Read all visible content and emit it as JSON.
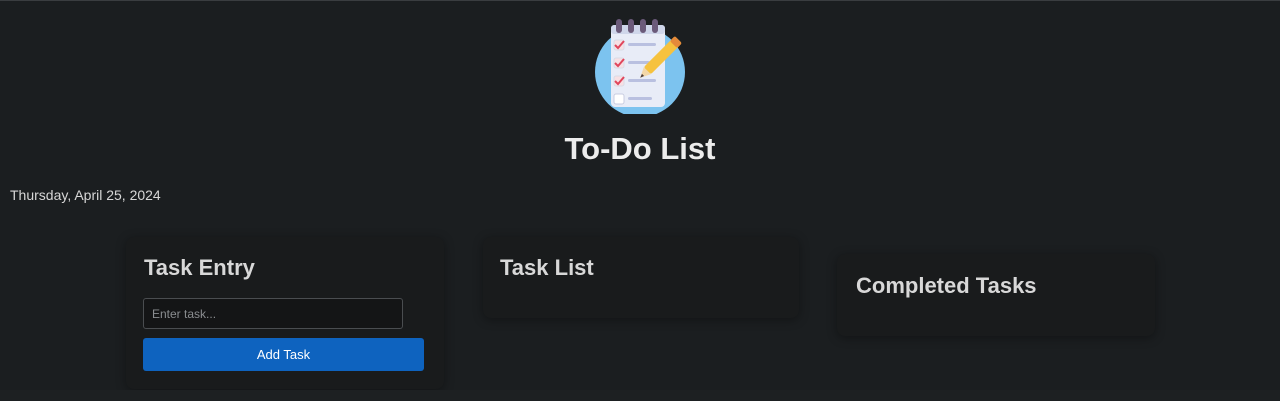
{
  "app": {
    "title": "To-Do List",
    "logo_icon": "notepad-checklist-pencil-icon",
    "date": "Thursday, April 25, 2024"
  },
  "task_entry": {
    "heading": "Task Entry",
    "input_value": "",
    "input_placeholder": "Enter task...",
    "add_button_label": "Add Task"
  },
  "task_list": {
    "heading": "Task List",
    "items": []
  },
  "completed_tasks": {
    "heading": "Completed Tasks",
    "items": []
  },
  "colors": {
    "background": "#1b1e20",
    "card": "#191b1c",
    "accent": "#0e63bf"
  }
}
